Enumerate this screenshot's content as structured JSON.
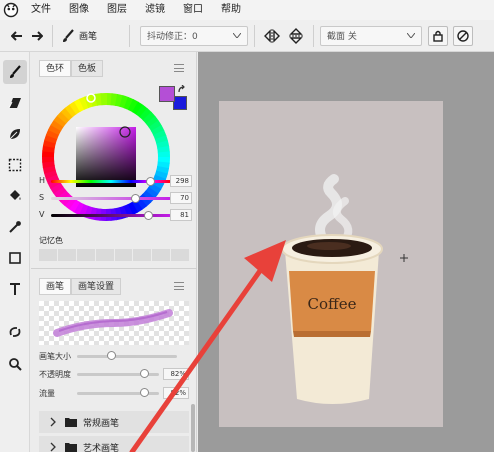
{
  "menu": [
    "文件",
    "图像",
    "图层",
    "滤镜",
    "窗口",
    "帮助"
  ],
  "toolbar": {
    "brush_label": "画笔",
    "stabilizer": "抖动修正：0",
    "symmetry": "截面 关"
  },
  "color_panel": {
    "tab_ring": "色环",
    "tab_swatch": "色板",
    "foreground": "#b44fd6",
    "background": "#1a1adc",
    "sliders": [
      {
        "key": "H",
        "value": "298",
        "level": 0.83
      },
      {
        "key": "S",
        "value": "70",
        "level": 0.7
      },
      {
        "key": "V",
        "value": "81",
        "level": 0.81
      }
    ],
    "memory_label": "记忆色"
  },
  "brush_panel": {
    "tab_brush": "画笔",
    "tab_settings": "画笔设置",
    "size_label": "画笔大小",
    "opacity_label": "不透明度",
    "opacity_value": "82%",
    "opacity_level": 0.82,
    "flow_label": "流量",
    "flow_value": "82%",
    "flow_level": 0.82,
    "categories": [
      "常规画笔",
      "艺术画笔"
    ]
  },
  "canvas": {
    "coffee_text": "Coffee"
  }
}
